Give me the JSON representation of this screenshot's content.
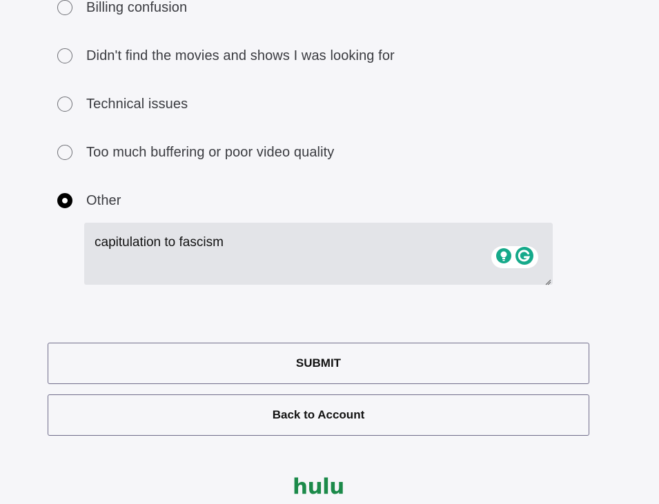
{
  "reasons": [
    {
      "label": "Billing confusion",
      "checked": false
    },
    {
      "label": "Didn't find the movies and shows I was looking for",
      "checked": false
    },
    {
      "label": "Technical issues",
      "checked": false
    },
    {
      "label": "Too much buffering or poor video quality",
      "checked": false
    },
    {
      "label": "Other",
      "checked": true
    }
  ],
  "other_text": {
    "value": "capitulation to fascism"
  },
  "grammarly": {
    "icons": [
      "lightbulb-icon",
      "grammarly-g-icon"
    ],
    "color": "#15a98a"
  },
  "buttons": {
    "submit_label": "SUBMIT",
    "back_label": "Back to Account"
  },
  "brand": {
    "logo_text": "hulu",
    "color": "#1c8a4a"
  }
}
